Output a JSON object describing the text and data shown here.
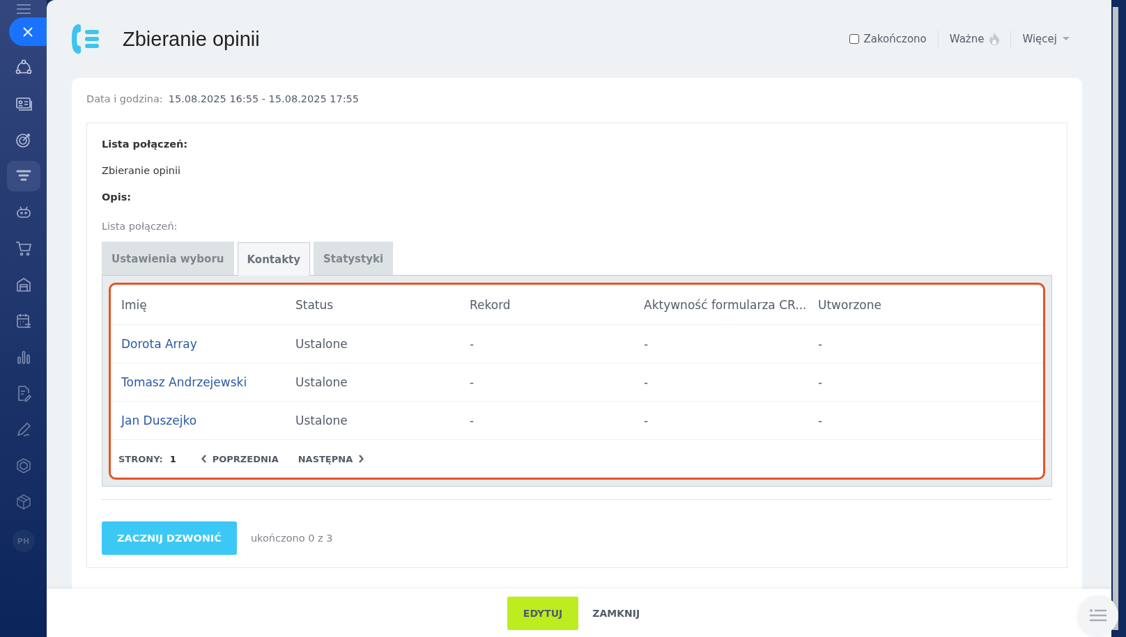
{
  "sidebar": {
    "items": [
      {
        "kind": "nodes",
        "selected": false
      },
      {
        "kind": "card",
        "selected": false
      },
      {
        "kind": "target",
        "selected": false
      },
      {
        "kind": "funnel",
        "selected": true
      },
      {
        "kind": "robot",
        "selected": false
      },
      {
        "kind": "cart",
        "selected": false
      },
      {
        "kind": "garage",
        "selected": false
      },
      {
        "kind": "calendar",
        "selected": false
      },
      {
        "kind": "bars",
        "selected": false
      },
      {
        "kind": "doc",
        "selected": false
      },
      {
        "kind": "pen",
        "selected": false
      },
      {
        "kind": "hexagon",
        "selected": false
      },
      {
        "kind": "box",
        "selected": false
      }
    ],
    "avatar": "PH"
  },
  "header": {
    "title": "Zbieranie opinii",
    "completed": {
      "label": "Zakończono",
      "checked": false
    },
    "important": "Ważne",
    "more": "Więcej"
  },
  "datetime": {
    "label": "Data i godzina:",
    "value": "15.08.2025 16:55 - 15.08.2025 17:55"
  },
  "details": {
    "list_label": "Lista połączeń:",
    "list_value": "Zbieranie opinii",
    "description_label": "Opis:",
    "section_label": "Lista połączeń:"
  },
  "tabs": [
    {
      "label": "Ustawienia wyboru",
      "selected": false
    },
    {
      "label": "Kontakty",
      "selected": true
    },
    {
      "label": "Statystyki",
      "selected": false
    }
  ],
  "table": {
    "columns": [
      "Imię",
      "Status",
      "Rekord",
      "Aktywność formularza CR...",
      "Utworzone"
    ],
    "rows": [
      [
        "Dorota Array",
        "Ustalone",
        "-",
        "-",
        "-"
      ],
      [
        "Tomasz Andrzejewski",
        "Ustalone",
        "-",
        "-",
        "-"
      ],
      [
        "Jan Duszejko",
        "Ustalone",
        "-",
        "-",
        "-"
      ]
    ]
  },
  "pagination": {
    "label": "STRONY:",
    "page": "1",
    "prev": "POPRZEDNIA",
    "next": "NASTĘPNA"
  },
  "start_button": "ZACZNIJ DZWONIĆ",
  "progress_text": "ukończono 0 z 3",
  "footer": {
    "edit": "EDYTUJ",
    "close": "ZAMKNIJ"
  }
}
